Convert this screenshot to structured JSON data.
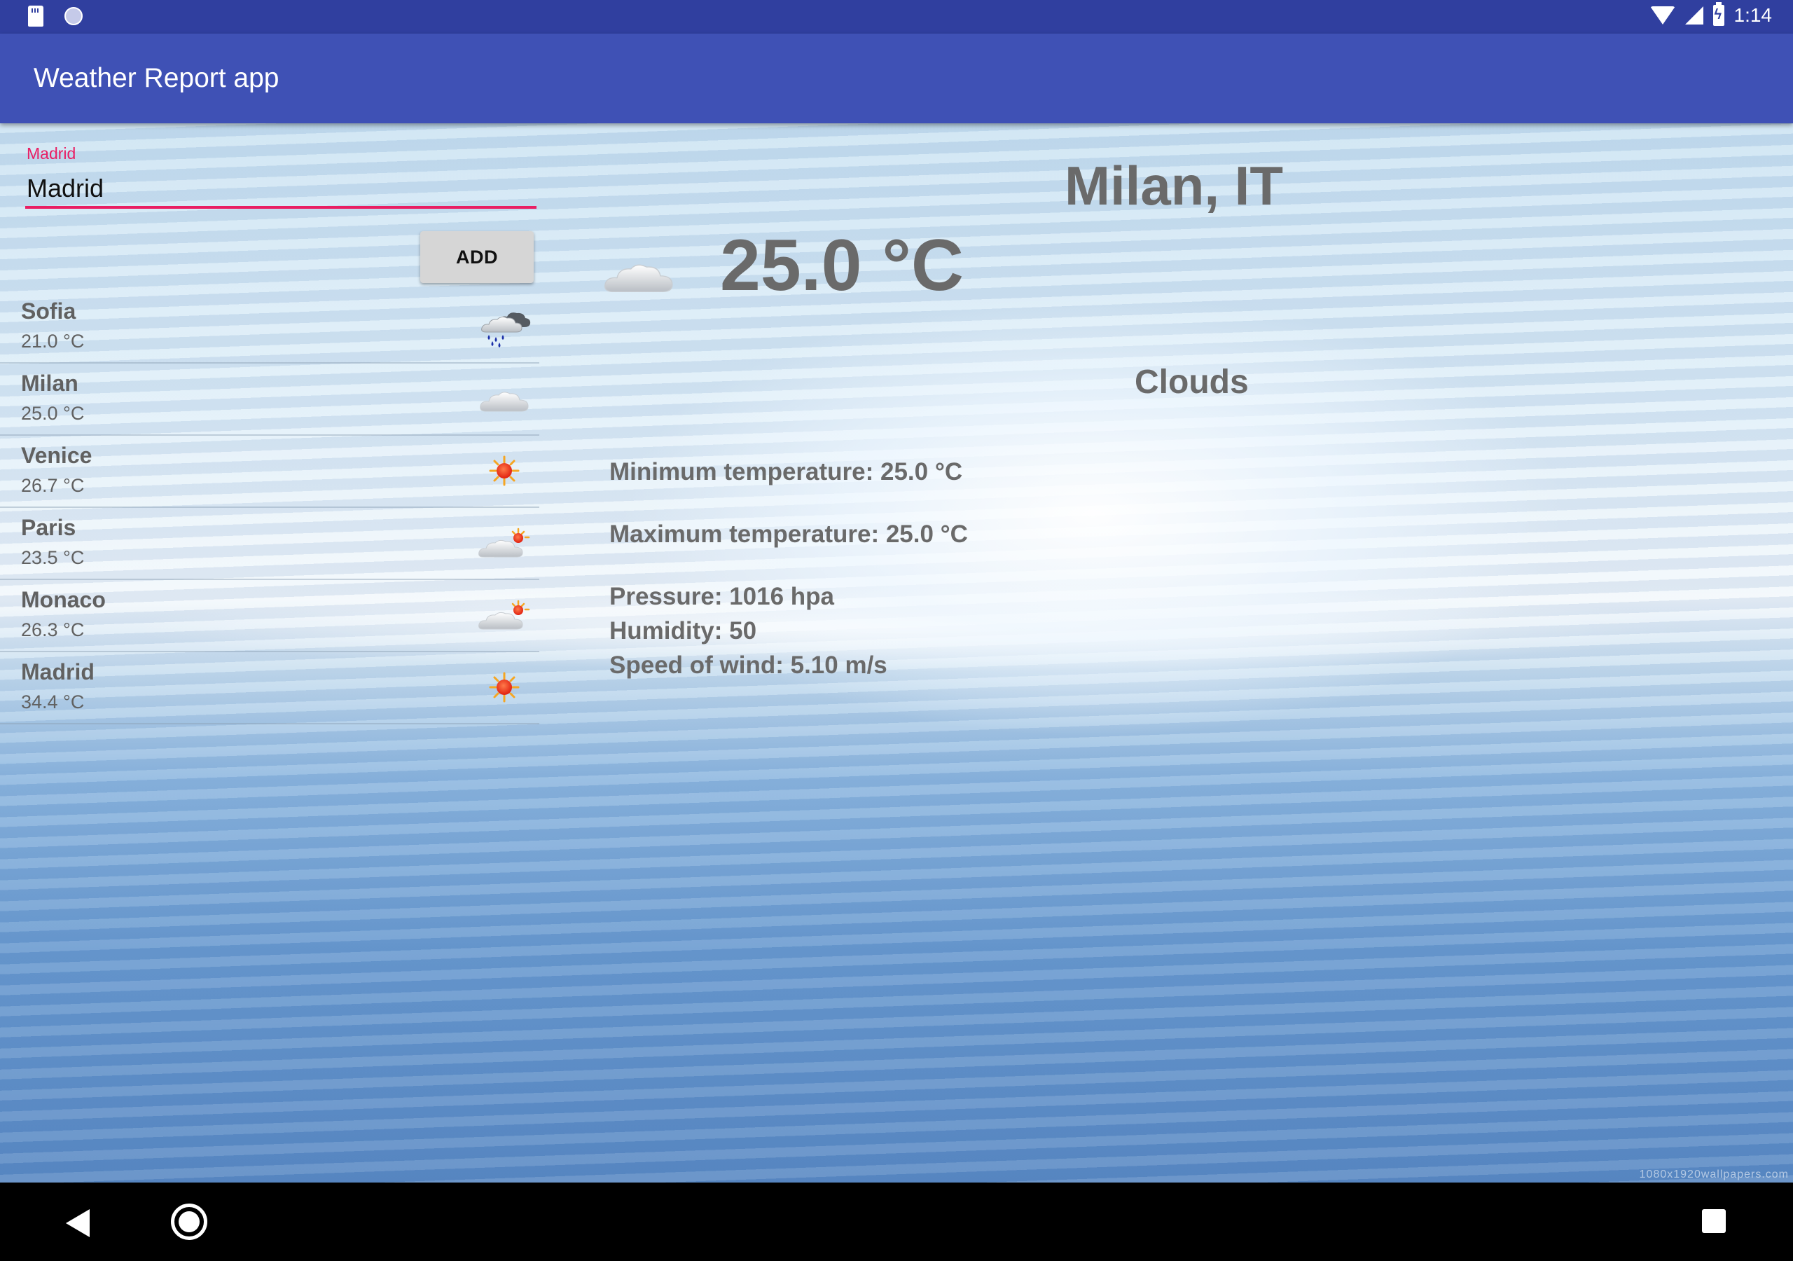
{
  "status_bar": {
    "time": "1:14"
  },
  "app_bar": {
    "title": "Weather Report app"
  },
  "search": {
    "label": "Madrid",
    "value": "Madrid",
    "add_label": "ADD"
  },
  "cities": [
    {
      "name": "Sofia",
      "temp": "21.0 °C",
      "icon": "rain-cloud-icon"
    },
    {
      "name": "Milan",
      "temp": "25.0 °C",
      "icon": "cloud-icon"
    },
    {
      "name": "Venice",
      "temp": "26.7 °C",
      "icon": "sun-icon"
    },
    {
      "name": "Paris",
      "temp": "23.5 °C",
      "icon": "partly-cloudy-icon"
    },
    {
      "name": "Monaco",
      "temp": "26.3 °C",
      "icon": "partly-cloudy-icon"
    },
    {
      "name": "Madrid",
      "temp": "34.4 °C",
      "icon": "sun-icon"
    }
  ],
  "detail": {
    "city": "Milan, IT",
    "temp": "25.0 °C",
    "icon": "cloud-icon",
    "description": "Clouds",
    "min_temp": "Minimum temperature: 25.0 °C",
    "max_temp": "Maximum temperature: 25.0 °C",
    "pressure": "Pressure: 1016 hpa",
    "humidity": "Humidity: 50",
    "wind": "Speed of wind: 5.10 m/s"
  },
  "watermark": "1080x1920wallpapers.com",
  "colors": {
    "primary": "#3f51b5",
    "primary_dark": "#303f9f",
    "accent": "#e91e63"
  }
}
